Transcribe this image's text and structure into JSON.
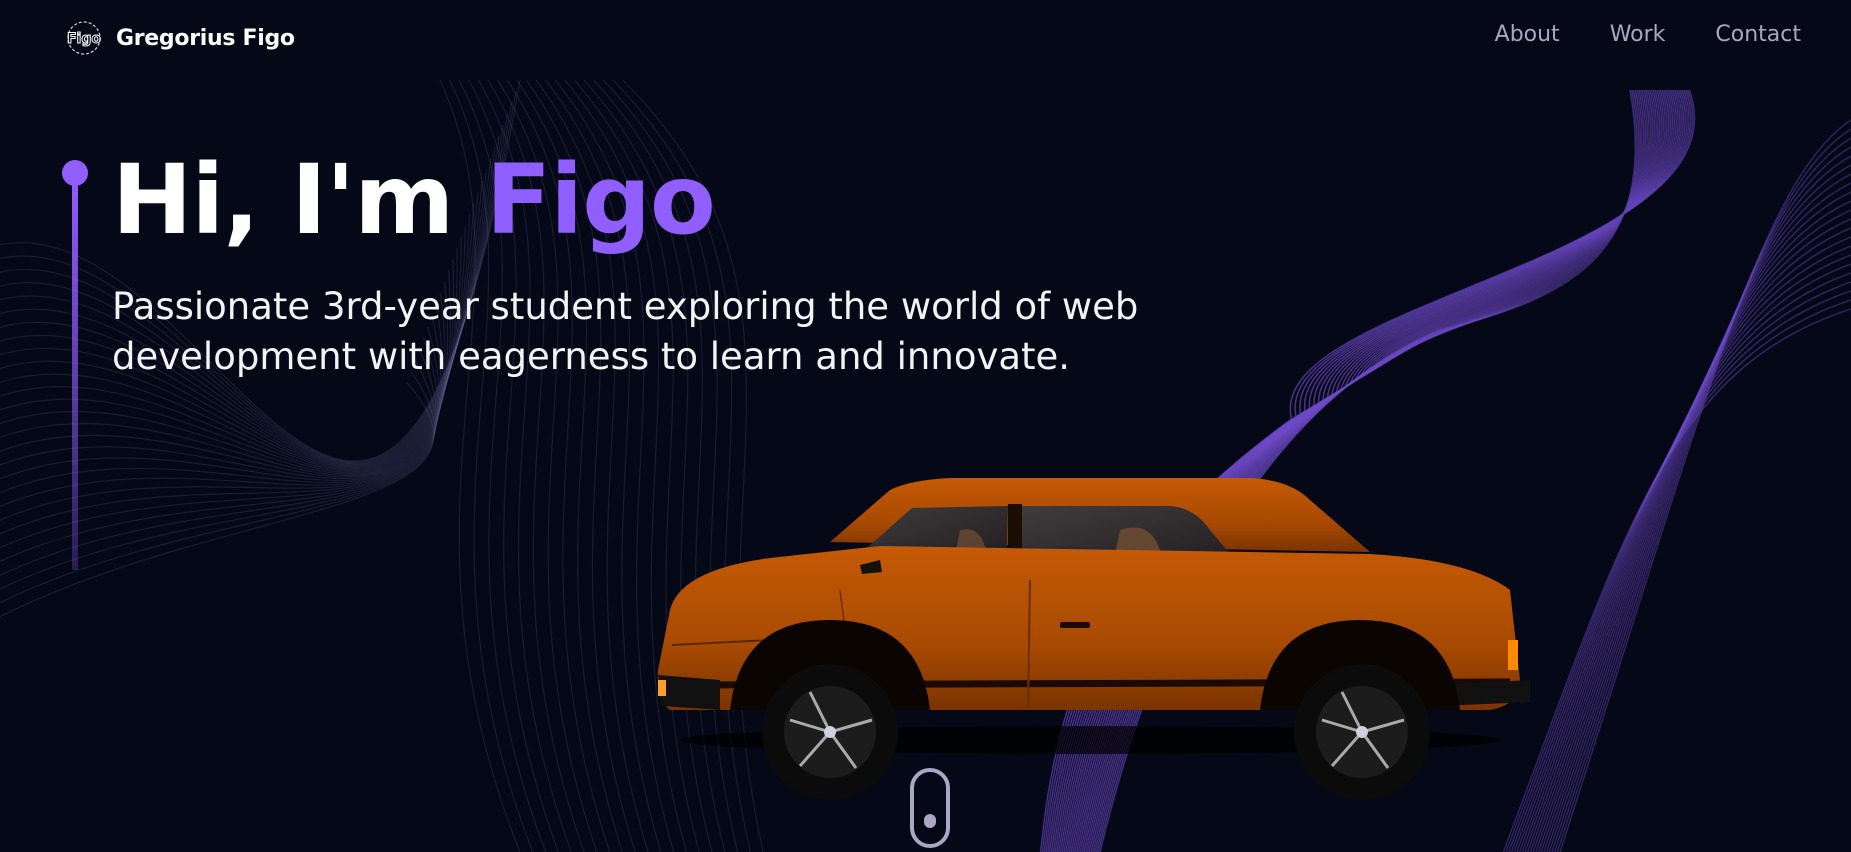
{
  "brand": {
    "logo_text": "Figo",
    "name": "Gregorius Figo"
  },
  "nav": {
    "links": [
      "About",
      "Work",
      "Contact"
    ]
  },
  "hero": {
    "title_prefix": "Hi, I'm ",
    "title_name": "Figo",
    "subtitle": "Passionate 3rd-year student exploring the world of web development with eagerness to learn and innovate."
  },
  "colors": {
    "background": "#050816",
    "accent": "#915eff",
    "nav_text": "#aaa6c3",
    "car_body": "#b14f03"
  },
  "icons": {
    "brand_logo": "figo-monogram-logo",
    "scroll": "mouse-scroll-icon"
  }
}
